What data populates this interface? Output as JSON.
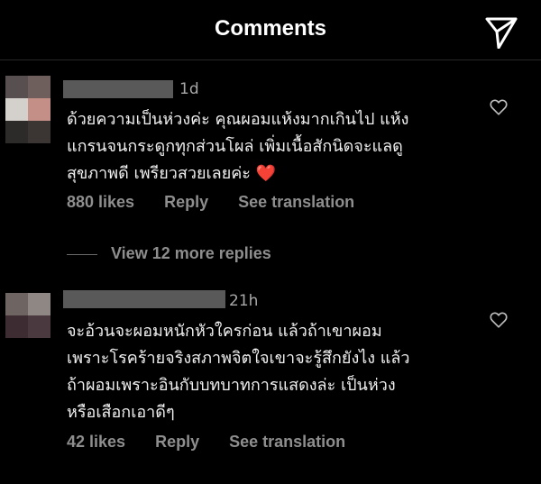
{
  "header": {
    "title": "Comments",
    "share_icon": "paper-plane-icon"
  },
  "comments": [
    {
      "time": "1d",
      "text_lines": [
        "ด้วยความเป็นห่วงค่ะ คุณผอมแห้งมากเกินไป แห้ง",
        "แกรนจนกระดูกทุกส่วนโผล่ เพิ่มเนื้อสักนิดจะแลดู",
        "สุขภาพดี เพรียวสวยเลยค่ะ "
      ],
      "emoji": "❤️",
      "likes": "880 likes",
      "reply": "Reply",
      "translate": "See translation"
    },
    {
      "time": "21h",
      "text_lines": [
        "จะอ้วนจะผอมหนักหัวใครก่อน แล้วถ้าเขาผอม",
        "เพราะโรคร้ายจริงสภาพจิตใจเขาจะรู้สึกยังไง แล้ว",
        "ถ้าผอมเพราะอินกับบทบาทการแสดงล่ะ เป็นห่วง",
        "หรือเสือกเอาดีๆ"
      ],
      "likes": "42 likes",
      "reply": "Reply",
      "translate": "See translation"
    }
  ],
  "view_replies": "View 12 more replies",
  "colors": {
    "background": "#000000",
    "text": "#f0f0f0",
    "muted": "#8e8e8e",
    "heart": "#ee1d3a"
  }
}
